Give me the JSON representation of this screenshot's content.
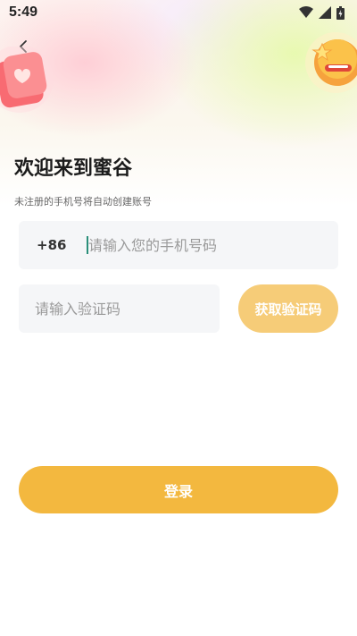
{
  "status_bar": {
    "time": "5:49",
    "icons": [
      "wifi-icon",
      "signal-icon",
      "battery-icon"
    ]
  },
  "header": {
    "back_icon": "chevron-left-icon",
    "title": "欢迎来到蜜谷",
    "subtitle": "未注册的手机号将自动创建账号"
  },
  "form": {
    "country_code": "+86",
    "phone_placeholder": "请输入您的手机号码",
    "phone_value": "",
    "code_placeholder": "请输入验证码",
    "code_value": "",
    "get_code_label": "获取验证码",
    "login_label": "登录"
  },
  "colors": {
    "primary": "#f3b83f",
    "primary_light": "#f6cc78",
    "input_bg": "#f5f6f8",
    "cursor": "#2a8f7a"
  }
}
